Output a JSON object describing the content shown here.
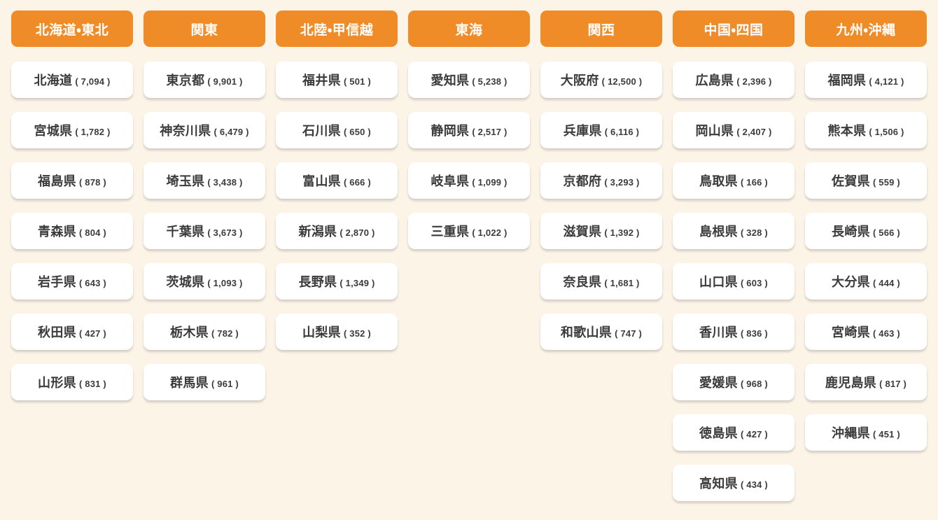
{
  "page": {
    "background_color": "#fdf4e8",
    "header_color": "#f08c28",
    "header_text_color": "#ffffff",
    "card_color": "#ffffff",
    "card_text_color": "#3b3b3b"
  },
  "regions": [
    {
      "header": "北海道・東北",
      "prefectures": [
        {
          "name": "北海道",
          "count": "( 7,094 )"
        },
        {
          "name": "宮城県",
          "count": "( 1,782 )"
        },
        {
          "name": "福島県",
          "count": "( 878 )"
        },
        {
          "name": "青森県",
          "count": "( 804 )"
        },
        {
          "name": "岩手県",
          "count": "( 643 )"
        },
        {
          "name": "秋田県",
          "count": "( 427 )"
        },
        {
          "name": "山形県",
          "count": "( 831 )"
        }
      ]
    },
    {
      "header": "関東",
      "prefectures": [
        {
          "name": "東京都",
          "count": "( 9,901 )"
        },
        {
          "name": "神奈川県",
          "count": "( 6,479 )"
        },
        {
          "name": "埼玉県",
          "count": "( 3,438 )"
        },
        {
          "name": "千葉県",
          "count": "( 3,673 )"
        },
        {
          "name": "茨城県",
          "count": "( 1,093 )"
        },
        {
          "name": "栃木県",
          "count": "( 782 )"
        },
        {
          "name": "群馬県",
          "count": "( 961 )"
        }
      ]
    },
    {
      "header": "北陸・甲信越",
      "prefectures": [
        {
          "name": "福井県",
          "count": "( 501 )"
        },
        {
          "name": "石川県",
          "count": "( 650 )"
        },
        {
          "name": "富山県",
          "count": "( 666 )"
        },
        {
          "name": "新潟県",
          "count": "( 2,870 )"
        },
        {
          "name": "長野県",
          "count": "( 1,349 )"
        },
        {
          "name": "山梨県",
          "count": "( 352 )"
        }
      ]
    },
    {
      "header": "東海",
      "prefectures": [
        {
          "name": "愛知県",
          "count": "( 5,238 )"
        },
        {
          "name": "静岡県",
          "count": "( 2,517 )"
        },
        {
          "name": "岐阜県",
          "count": "( 1,099 )"
        },
        {
          "name": "三重県",
          "count": "( 1,022 )"
        }
      ]
    },
    {
      "header": "関西",
      "prefectures": [
        {
          "name": "大阪府",
          "count": "( 12,500 )"
        },
        {
          "name": "兵庫県",
          "count": "( 6,116 )"
        },
        {
          "name": "京都府",
          "count": "( 3,293 )"
        },
        {
          "name": "滋賀県",
          "count": "( 1,392 )"
        },
        {
          "name": "奈良県",
          "count": "( 1,681 )"
        },
        {
          "name": "和歌山県",
          "count": "( 747 )"
        }
      ]
    },
    {
      "header": "中国・四国",
      "prefectures": [
        {
          "name": "広島県",
          "count": "( 2,396 )"
        },
        {
          "name": "岡山県",
          "count": "( 2,407 )"
        },
        {
          "name": "鳥取県",
          "count": "( 166 )"
        },
        {
          "name": "島根県",
          "count": "( 328 )"
        },
        {
          "name": "山口県",
          "count": "( 603 )"
        },
        {
          "name": "香川県",
          "count": "( 836 )"
        },
        {
          "name": "愛媛県",
          "count": "( 968 )"
        },
        {
          "name": "徳島県",
          "count": "( 427 )"
        },
        {
          "name": "高知県",
          "count": "( 434 )"
        }
      ]
    },
    {
      "header": "九州・沖縄",
      "prefectures": [
        {
          "name": "福岡県",
          "count": "( 4,121 )"
        },
        {
          "name": "熊本県",
          "count": "( 1,506 )"
        },
        {
          "name": "佐賀県",
          "count": "( 559 )"
        },
        {
          "name": "長崎県",
          "count": "( 566 )"
        },
        {
          "name": "大分県",
          "count": "( 444 )"
        },
        {
          "name": "宮崎県",
          "count": "( 463 )"
        },
        {
          "name": "鹿児島県",
          "count": "( 817 )"
        },
        {
          "name": "沖縄県",
          "count": "( 451 )"
        }
      ]
    }
  ]
}
